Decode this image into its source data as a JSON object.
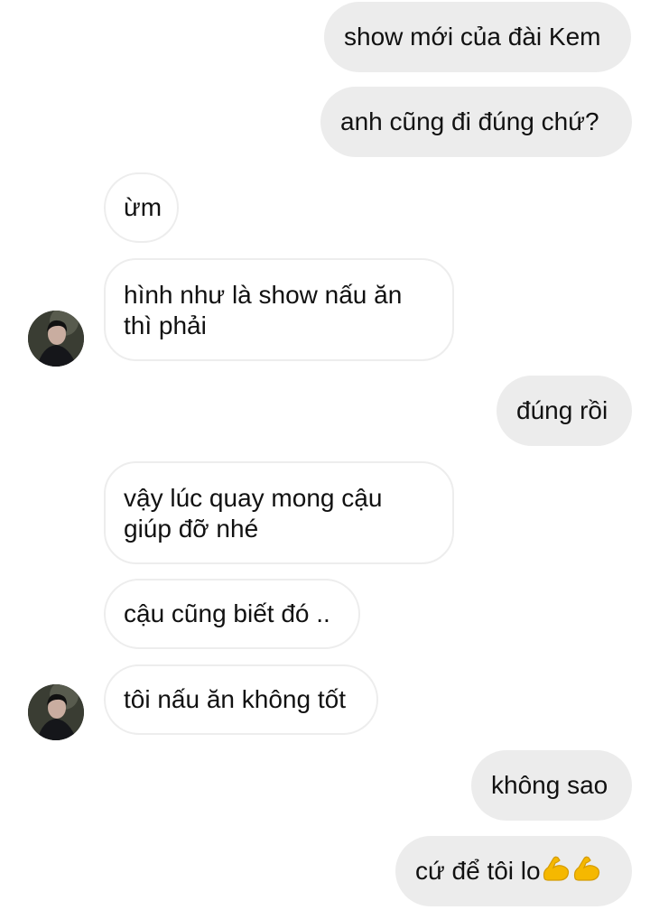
{
  "messages": [
    {
      "side": "outgoing",
      "text": "show mới của đài Kem"
    },
    {
      "side": "outgoing",
      "text": "anh cũng đi đúng chứ?"
    },
    {
      "side": "incoming",
      "text": "ừm"
    },
    {
      "side": "incoming",
      "line1": "hình như là show nấu ăn",
      "line2": "thì phải",
      "avatar": "contact-avatar"
    },
    {
      "side": "outgoing",
      "text": "đúng rồi"
    },
    {
      "side": "incoming",
      "line1": "vậy lúc quay mong cậu",
      "line2": "giúp đỡ nhé"
    },
    {
      "side": "incoming",
      "text": "cậu cũng biết đó .."
    },
    {
      "side": "incoming",
      "text": "tôi nấu ăn không tốt",
      "avatar": "contact-avatar"
    },
    {
      "side": "outgoing",
      "text": "không sao"
    },
    {
      "side": "outgoing",
      "text": "cứ để tôi lo",
      "emoji": [
        "flexed-biceps-icon",
        "flexed-biceps-icon"
      ]
    }
  ],
  "colors": {
    "outgoing_bubble": "#ececec",
    "incoming_border": "#ededed",
    "text": "#111111",
    "emoji": "#f5b800"
  }
}
